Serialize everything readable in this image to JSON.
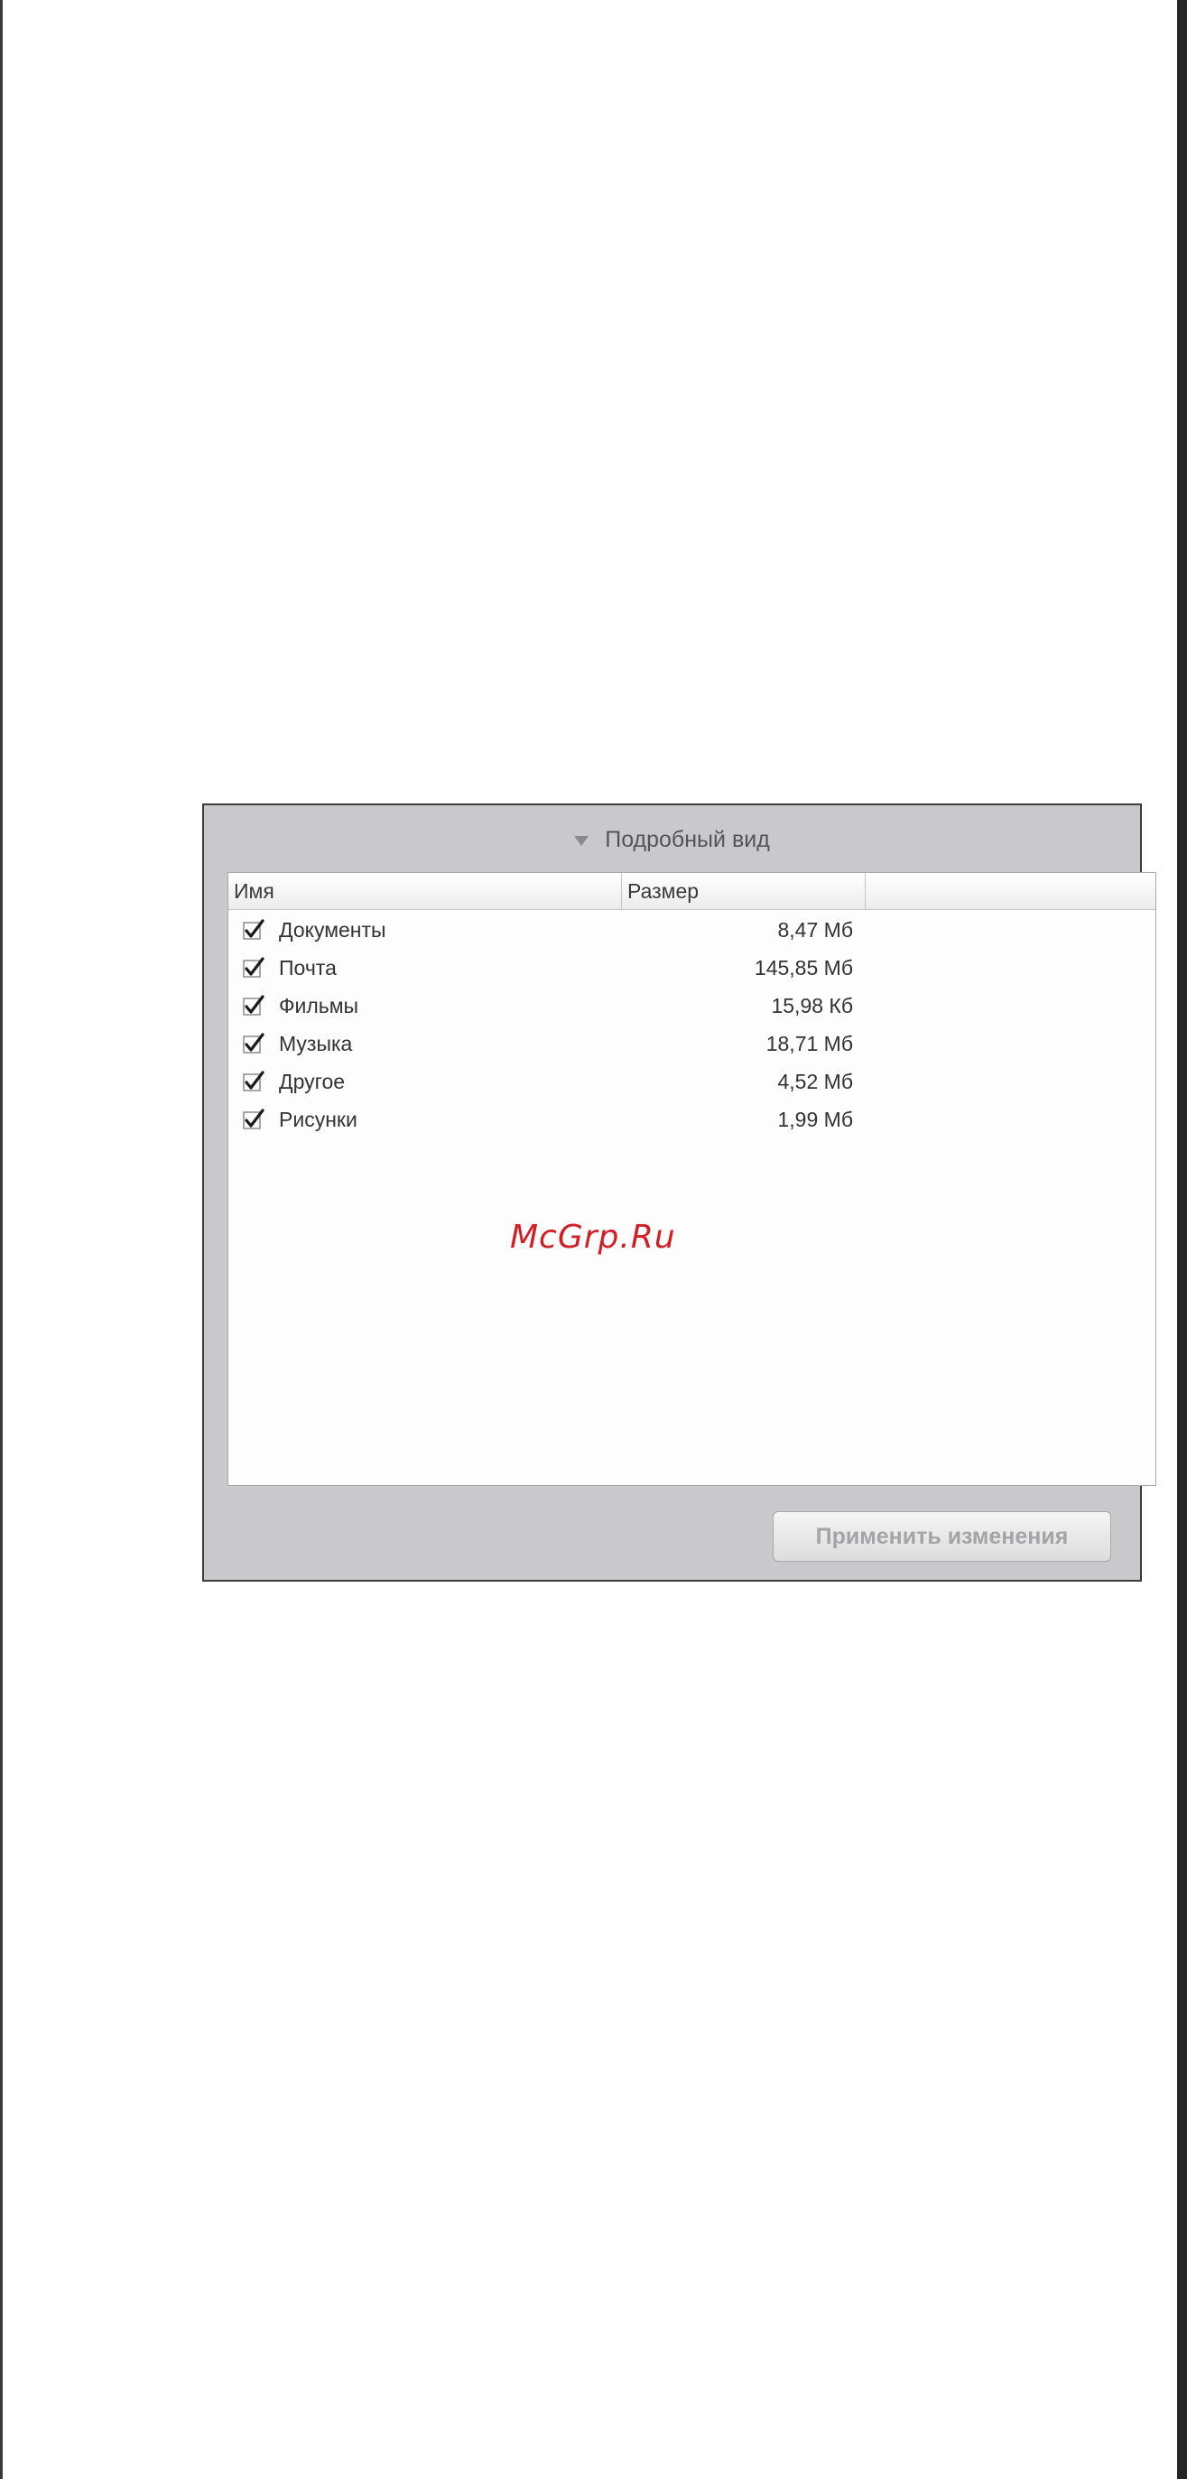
{
  "dialog": {
    "header_title": "Подробный вид",
    "header_icon": "triangle-down-icon",
    "columns": {
      "name": "Имя",
      "size": "Размер"
    },
    "items": [
      {
        "label": "Документы",
        "size": "8,47 Мб",
        "checked": true
      },
      {
        "label": "Почта",
        "size": "145,85 Мб",
        "checked": true
      },
      {
        "label": "Фильмы",
        "size": "15,98 Кб",
        "checked": true
      },
      {
        "label": "Музыка",
        "size": "18,71 Мб",
        "checked": true
      },
      {
        "label": "Другое",
        "size": "4,52 Мб",
        "checked": true
      },
      {
        "label": "Рисунки",
        "size": "1,99 Мб",
        "checked": true
      }
    ],
    "apply_button": {
      "label": "Применить изменения",
      "disabled": true
    }
  },
  "watermark": "McGrp.Ru",
  "colors": {
    "dialog_background": "#c9c9cc",
    "list_background": "#fdfdfd",
    "watermark": "#d21f26",
    "disabled_text": "#a4a4a7"
  }
}
